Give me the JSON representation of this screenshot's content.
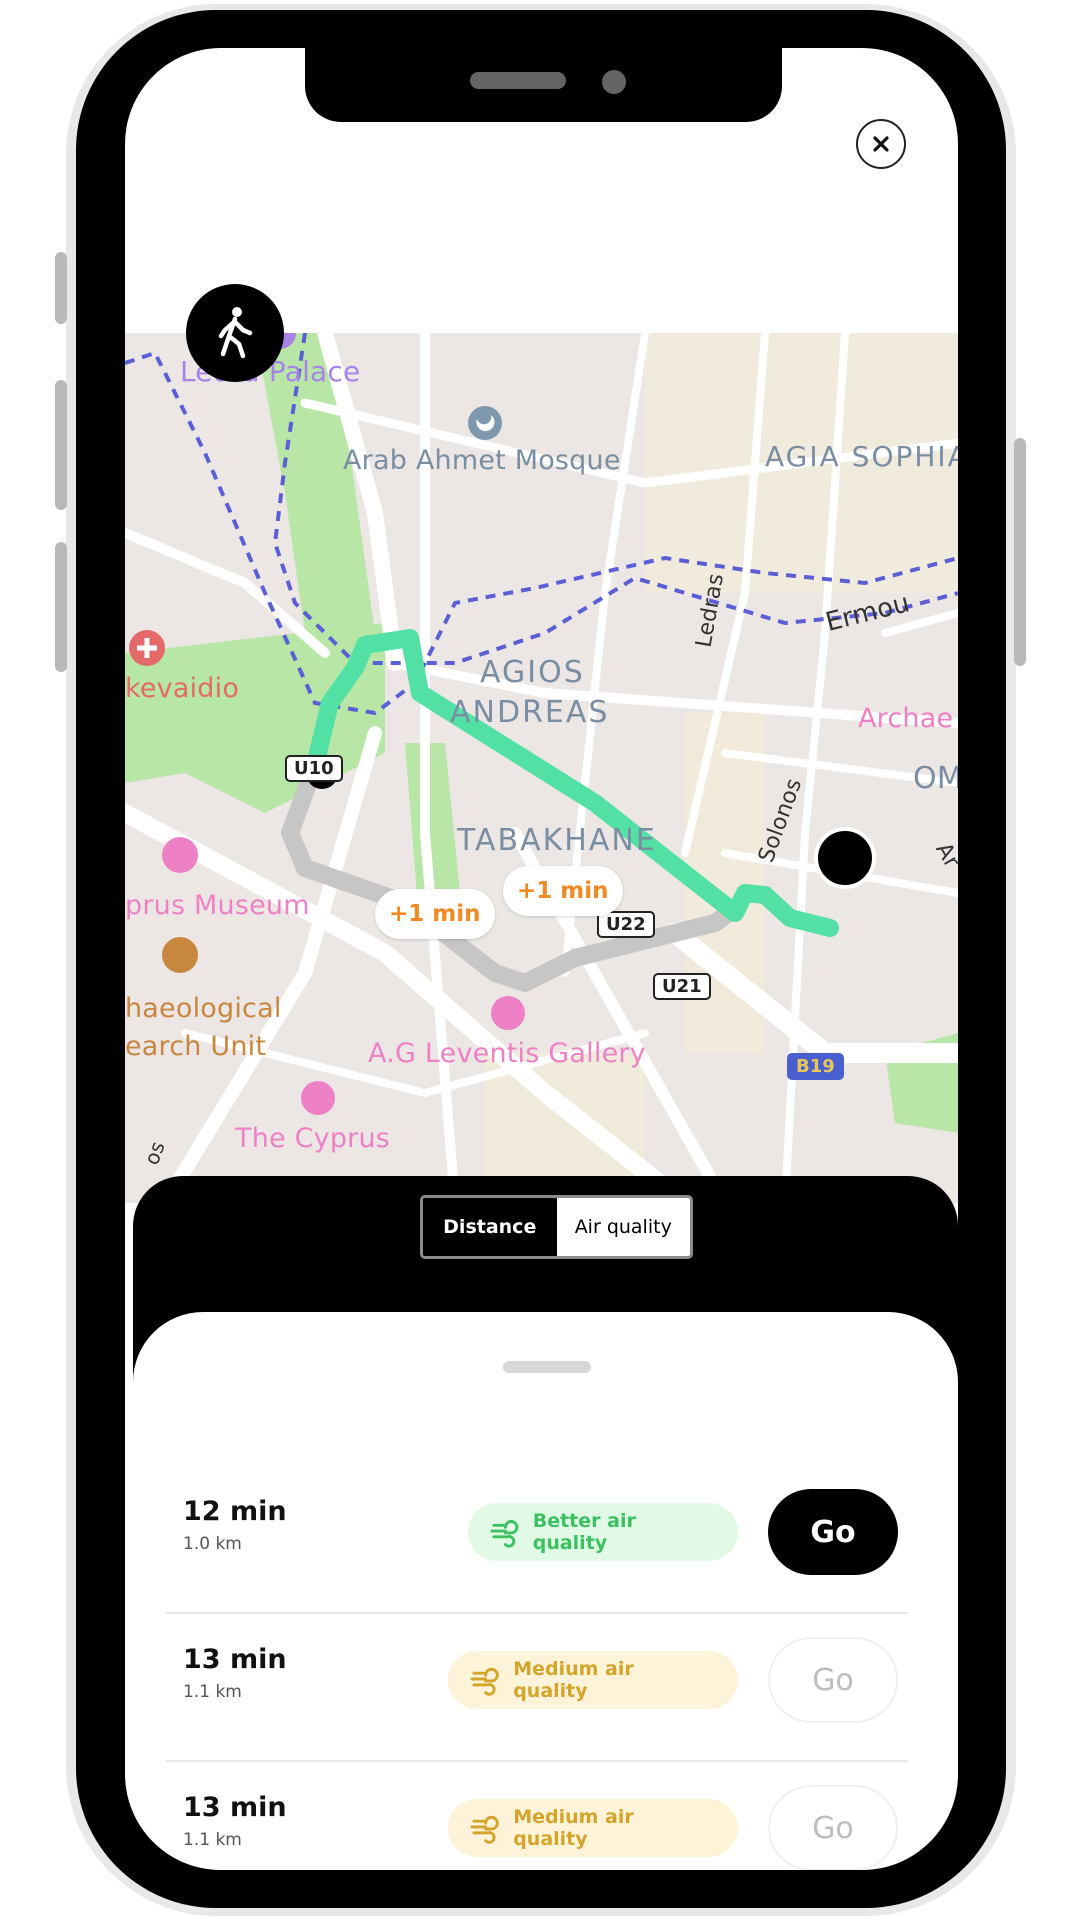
{
  "header": {
    "close_icon": "close-icon"
  },
  "map": {
    "labels": {
      "ledra_palace": "Ledra Palace",
      "arab_ahmet": "Arab Ahmet Mosque",
      "agia_sophia": "AGIA SOPHIA",
      "ermou": "Ermou",
      "ledras": "Ledras",
      "kevaidio": "kevaidio",
      "agios": "AGIOS",
      "andreas": "ANDREAS",
      "archae": "Archae",
      "om": "OM",
      "solonos": "Solonos",
      "tabakhane": "TABAKHANE",
      "cyprus_museum": "prus Museum",
      "archaeological": "haeological",
      "research_unit": "earch Unit",
      "leventis": "A.G Leventis Gallery",
      "the_cyprus": "The Cyprus",
      "os": "os",
      "ar": "Ar"
    },
    "road_badges": {
      "u10": "U10",
      "u22": "U22",
      "u21": "U21",
      "b19": "B19"
    },
    "delay_pills": [
      "+1 min",
      "+1 min"
    ],
    "colors": {
      "route_primary": "#52e0a4",
      "route_alt": "#c6c6c6",
      "walk_path": "#5b5fd6",
      "park": "#b8e6a6"
    }
  },
  "walk_fab": {
    "icon": "walking-person-icon"
  },
  "sort_toggle": {
    "options": [
      "Distance",
      "Air quality"
    ],
    "selected": "Air quality"
  },
  "routes": [
    {
      "time": "12 min",
      "distance": "1.0 km",
      "air_quality": "Better air quality",
      "level": "better",
      "go": "Go",
      "primary": true
    },
    {
      "time": "13 min",
      "distance": "1.1 km",
      "air_quality": "Medium air quality",
      "level": "medium",
      "go": "Go",
      "primary": false
    },
    {
      "time": "13 min",
      "distance": "1.1 km",
      "air_quality": "Medium air quality",
      "level": "medium",
      "go": "Go",
      "primary": false
    }
  ],
  "colors": {
    "better_bg": "#e0fae6",
    "better_text": "#3cc160",
    "medium_bg": "#fdf3d9",
    "medium_text": "#d4a52a"
  }
}
